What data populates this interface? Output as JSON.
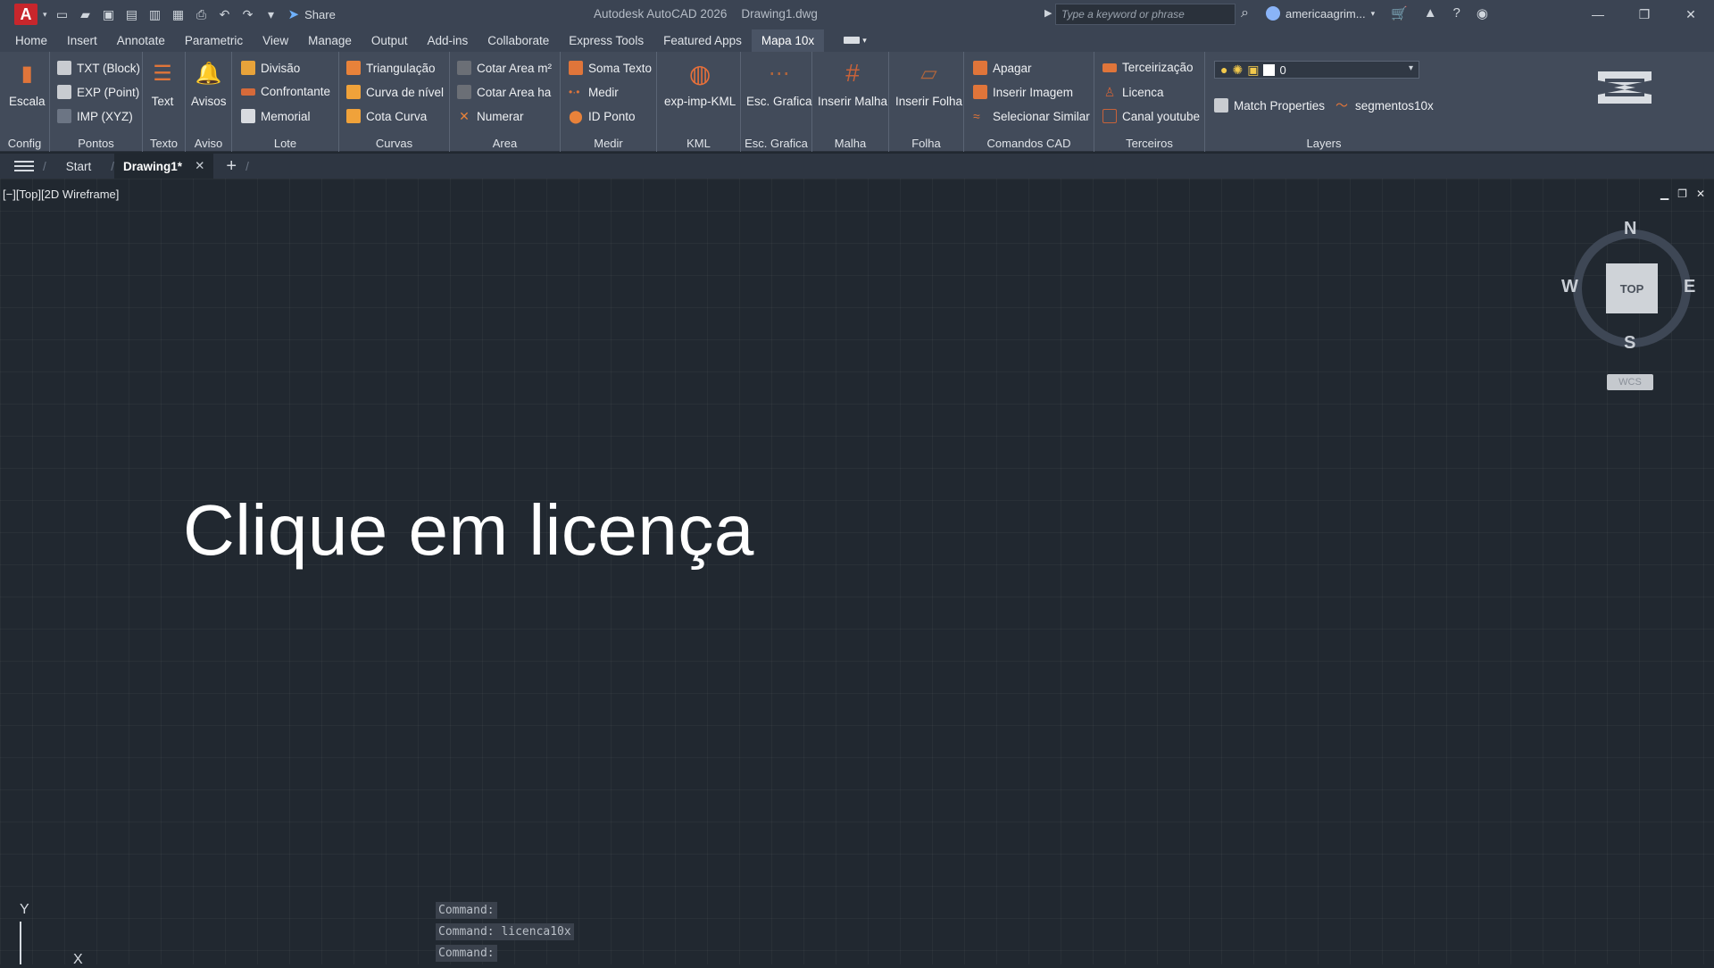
{
  "titlebar": {
    "app_letter": "A",
    "share_label": "Share",
    "app_title": "Autodesk AutoCAD 2026",
    "doc_title": "Drawing1.dwg",
    "search_placeholder": "Type a keyword or phrase",
    "user": "americaagrim..."
  },
  "tabs": [
    "Home",
    "Insert",
    "Annotate",
    "Parametric",
    "View",
    "Manage",
    "Output",
    "Add-ins",
    "Collaborate",
    "Express Tools",
    "Featured Apps",
    "Mapa 10x"
  ],
  "active_tab": "Mapa 10x",
  "ribbon": {
    "config": {
      "title": "Config",
      "escala": "Escala"
    },
    "pontos": {
      "title": "Pontos",
      "items": [
        "TXT (Block)",
        "EXP (Point)",
        "IMP (XYZ)"
      ]
    },
    "texto": {
      "title": "Texto",
      "text": "Text"
    },
    "aviso": {
      "title": "Aviso",
      "avisos": "Avisos"
    },
    "lote": {
      "title": "Lote",
      "items": [
        "Divisão",
        "Confrontante",
        "Memorial"
      ]
    },
    "curvas": {
      "title": "Curvas",
      "items": [
        "Triangulação",
        "Curva de nível",
        "Cota Curva"
      ]
    },
    "area": {
      "title": "Area",
      "items": [
        "Cotar Area m²",
        "Cotar Area ha",
        "Numerar"
      ]
    },
    "medir": {
      "title": "Medir",
      "items": [
        "Soma Texto",
        "Medir",
        "ID Ponto"
      ]
    },
    "kml": {
      "title": "KML",
      "btn": "exp-imp-KML"
    },
    "escgrafica": {
      "title": "Esc. Grafica",
      "btn": "Esc. Grafica"
    },
    "malha": {
      "title": "Malha",
      "btn": "Inserir Malha"
    },
    "folha": {
      "title": "Folha",
      "btn": "Inserir Folha"
    },
    "comandos": {
      "title": "Comandos CAD",
      "items": [
        "Apagar",
        "Inserir Imagem",
        "Selecionar Similar"
      ]
    },
    "terceiros": {
      "title": "Terceiros",
      "items": [
        "Terceirização",
        "Licenca",
        "Canal youtube"
      ]
    },
    "layers": {
      "title": "Layers",
      "current_layer": "0",
      "match": "Match Properties",
      "segmentos": "segmentos10x"
    }
  },
  "doctabs": {
    "start": "Start",
    "active": "Drawing1*"
  },
  "viewport": {
    "label": "[−][Top][2D Wireframe]",
    "cube_top": "TOP",
    "north": "N",
    "south": "S",
    "east": "E",
    "west": "W",
    "wcs": "WCS"
  },
  "caption": "Clique em licença",
  "command_lines": [
    "Command:",
    "Command: licenca10x",
    "Command:"
  ],
  "ucs": {
    "x": "X",
    "y": "Y"
  },
  "colors": {
    "accent": "#c8262c",
    "canvas": "#212830",
    "ribbon": "#424b5a"
  }
}
